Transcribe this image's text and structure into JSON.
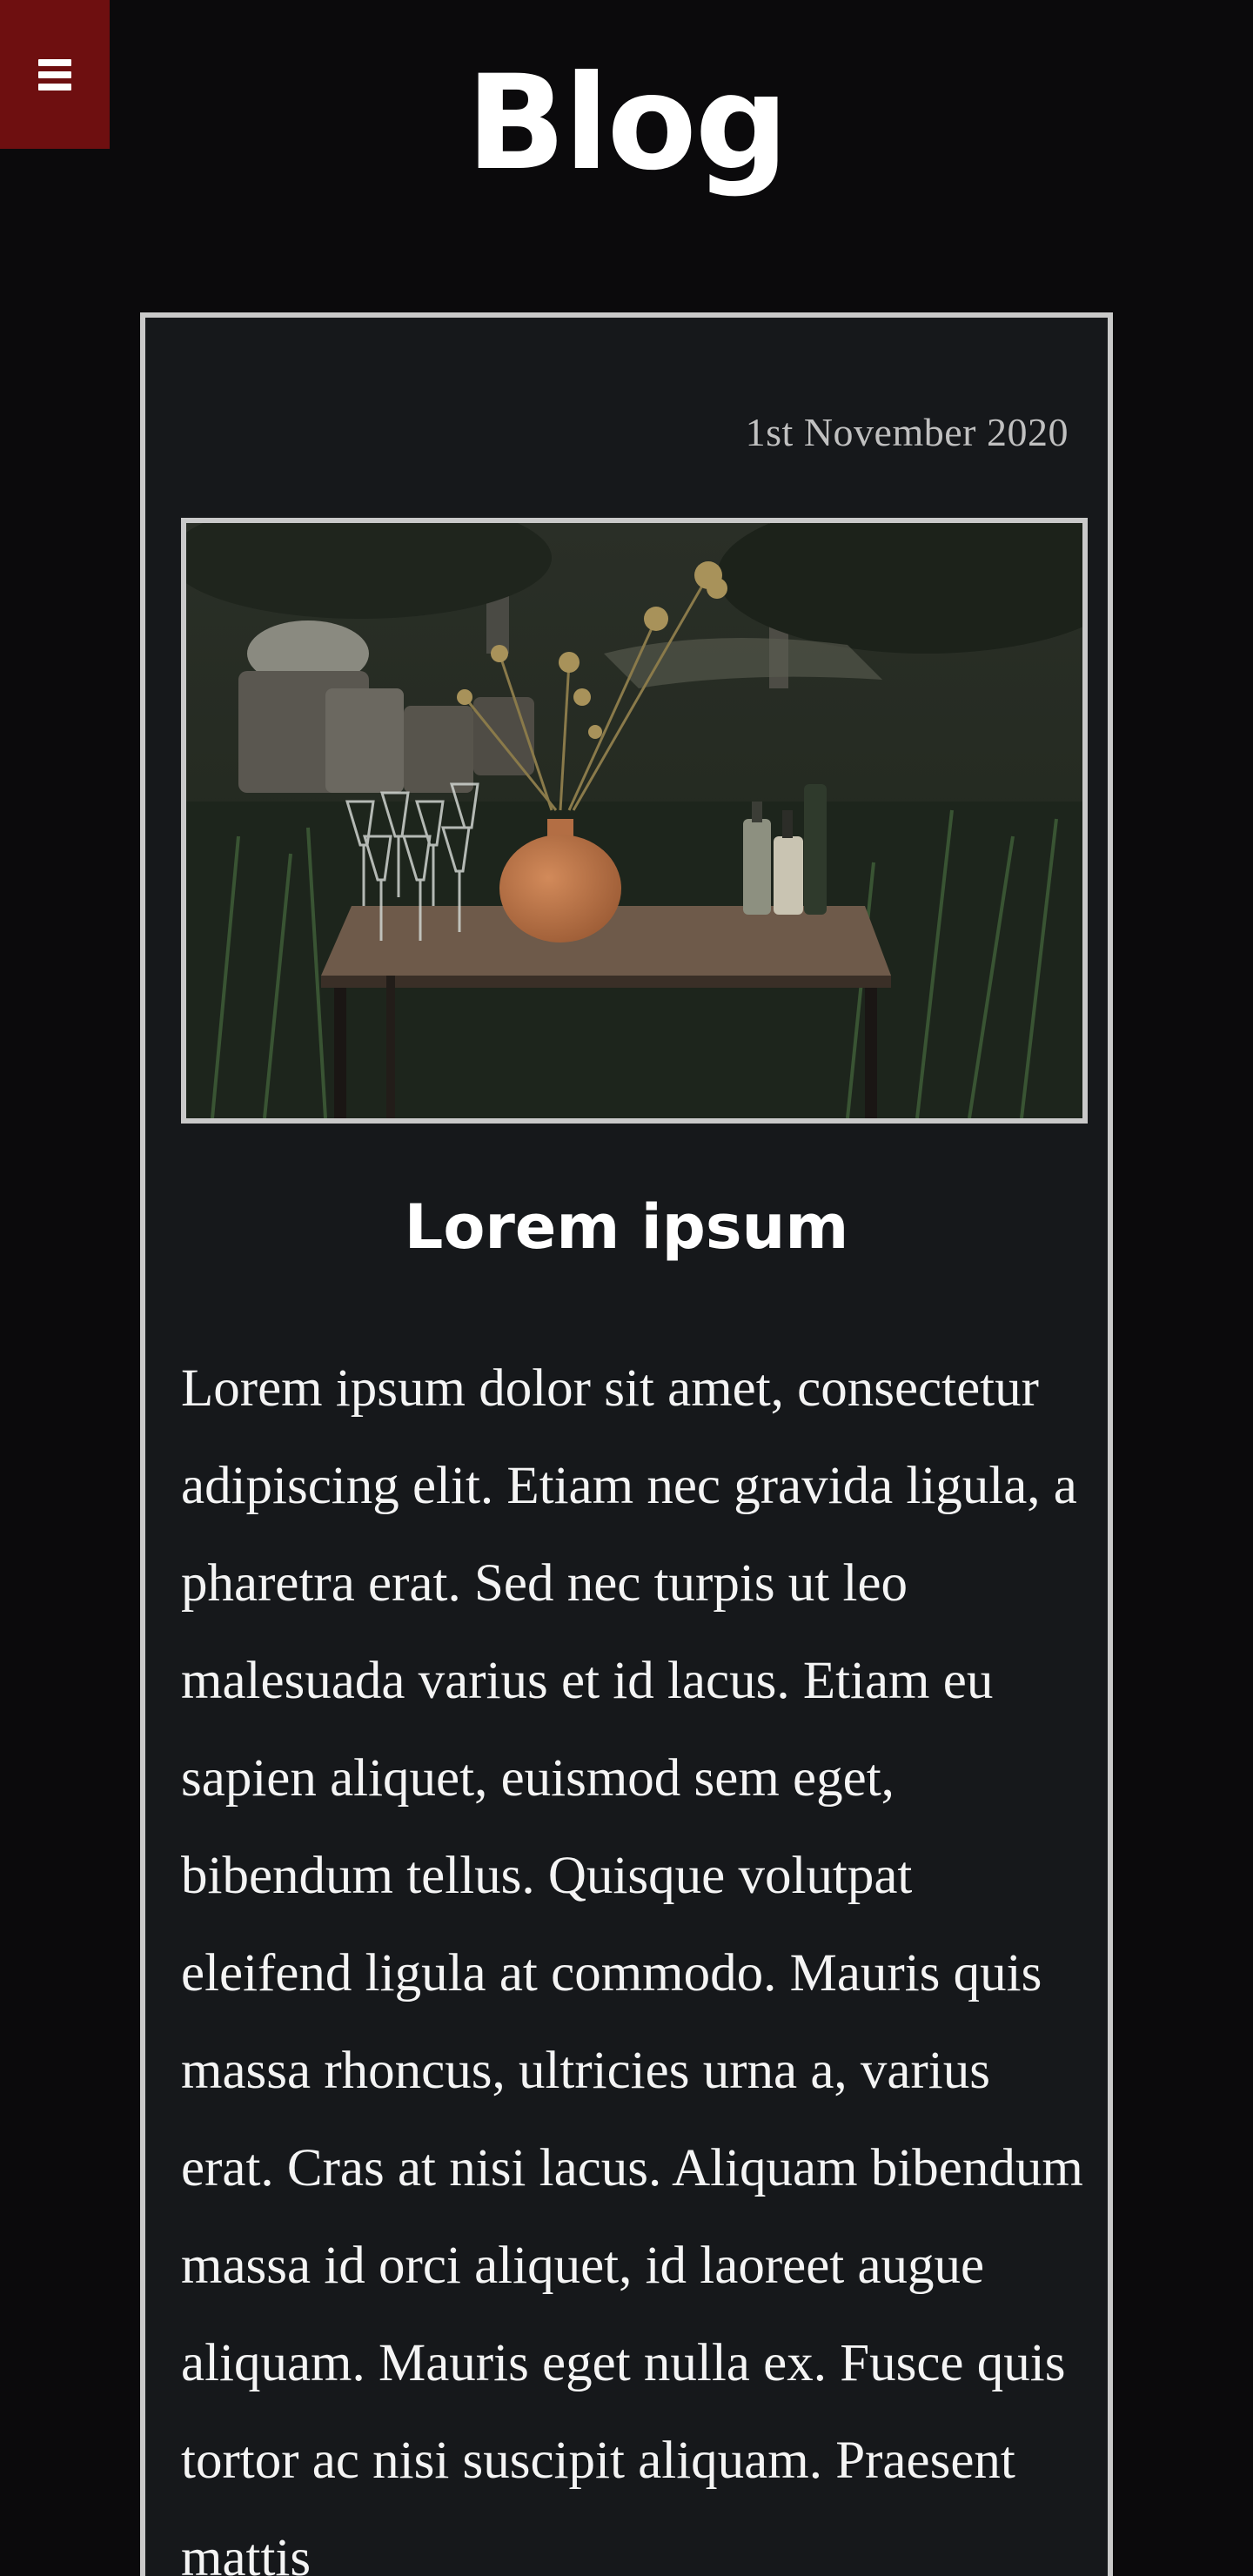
{
  "menu": {
    "icon": "hamburger-menu-icon",
    "color": "#6e0f10"
  },
  "header": {
    "title": "Blog"
  },
  "post": {
    "date": "1st November 2020",
    "image_icon": "photo-table-vase-glasses",
    "title": "Lorem ipsum",
    "body": "Lorem ipsum dolor sit amet, consectetur adipiscing elit. Etiam nec gravida ligula, a pharetra erat. Sed nec turpis ut leo malesuada varius et id lacus. Etiam eu sapien aliquet, euismod sem eget, bibendum tellus. Quisque volutpat eleifend ligula at commodo. Mauris quis massa rhoncus, ultricies urna a, varius erat. Cras at nisi lacus. Aliquam bibendum massa id orci aliquet, id laoreet augue aliquam. Mauris eget nulla ex. Fusce quis tortor ac nisi suscipit aliquam. Praesent mattis"
  },
  "colors": {
    "background": "#0b0a0c",
    "card": "#16181b",
    "border": "#c9c9c9"
  }
}
